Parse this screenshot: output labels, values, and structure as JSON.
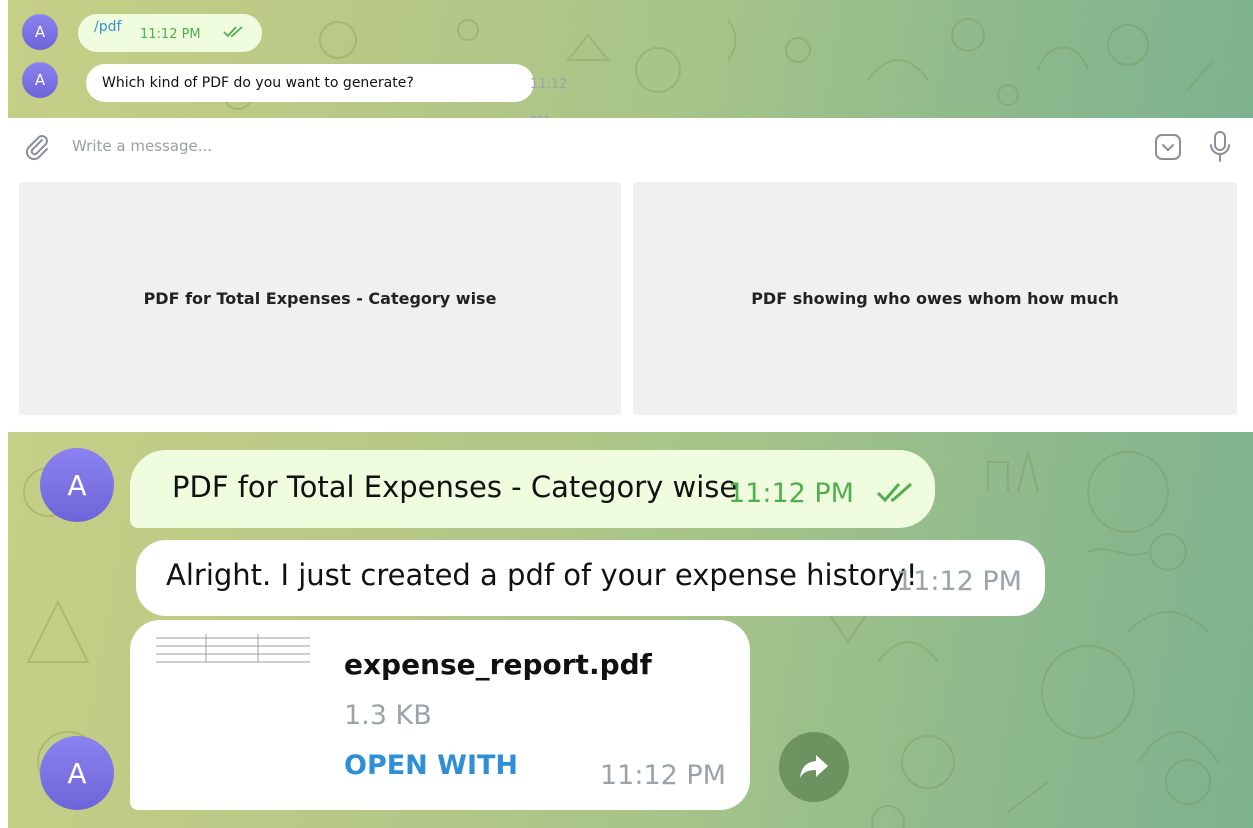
{
  "top_chat": {
    "avatar_letter": "A",
    "messages": [
      {
        "text": "/pdf",
        "time": "11:12 PM",
        "direction": "outgoing",
        "status": "read"
      },
      {
        "text": "Which kind of PDF do you want to generate?",
        "time": "11:12 PM",
        "direction": "incoming"
      }
    ]
  },
  "composer": {
    "placeholder": "Write a message..."
  },
  "keyboard": {
    "buttons": [
      {
        "label": "PDF for Total Expenses - Category wise"
      },
      {
        "label": "PDF showing who owes whom how much"
      }
    ]
  },
  "bottom_chat": {
    "avatar_letter": "A",
    "messages": [
      {
        "text": "PDF for Total Expenses - Category wise",
        "time": "11:12 PM",
        "direction": "outgoing",
        "status": "read"
      },
      {
        "text": "Alright. I just created a pdf of your expense history!",
        "time": "11:12 PM",
        "direction": "incoming"
      }
    ],
    "file": {
      "name": "expense_report.pdf",
      "size": "1.3 KB",
      "action": "OPEN WITH",
      "time": "11:12 PM"
    }
  },
  "colors": {
    "outgoing_bubble": "#effdde",
    "read_ticks": "#4fae4e",
    "link_blue": "#2e8fd8",
    "avatar": "#7a70e4"
  },
  "icons": [
    "attach-icon",
    "keyboard-toggle-icon",
    "microphone-icon",
    "double-check-icon",
    "forward-icon",
    "pdf-thumbnail-icon"
  ]
}
